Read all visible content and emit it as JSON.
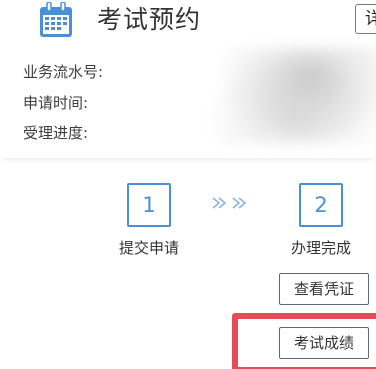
{
  "header": {
    "title": "考试预约",
    "cut_button_label": "详"
  },
  "info": {
    "serial_label": "业务流水号:",
    "apply_time_label": "申请时间:",
    "progress_label": "受理进度:"
  },
  "steps": [
    {
      "number": "1",
      "label": "提交申请"
    },
    {
      "number": "2",
      "label": "办理完成"
    }
  ],
  "step_arrows": "»»",
  "actions": {
    "view_certificate": "查看凭证",
    "exam_score": "考试成绩"
  },
  "colors": {
    "accent": "#4a90d9",
    "highlight": "#e54c58",
    "text": "#333333"
  },
  "icons": {
    "calendar": "calendar-icon",
    "arrows": "double-chevron-right-icon"
  }
}
